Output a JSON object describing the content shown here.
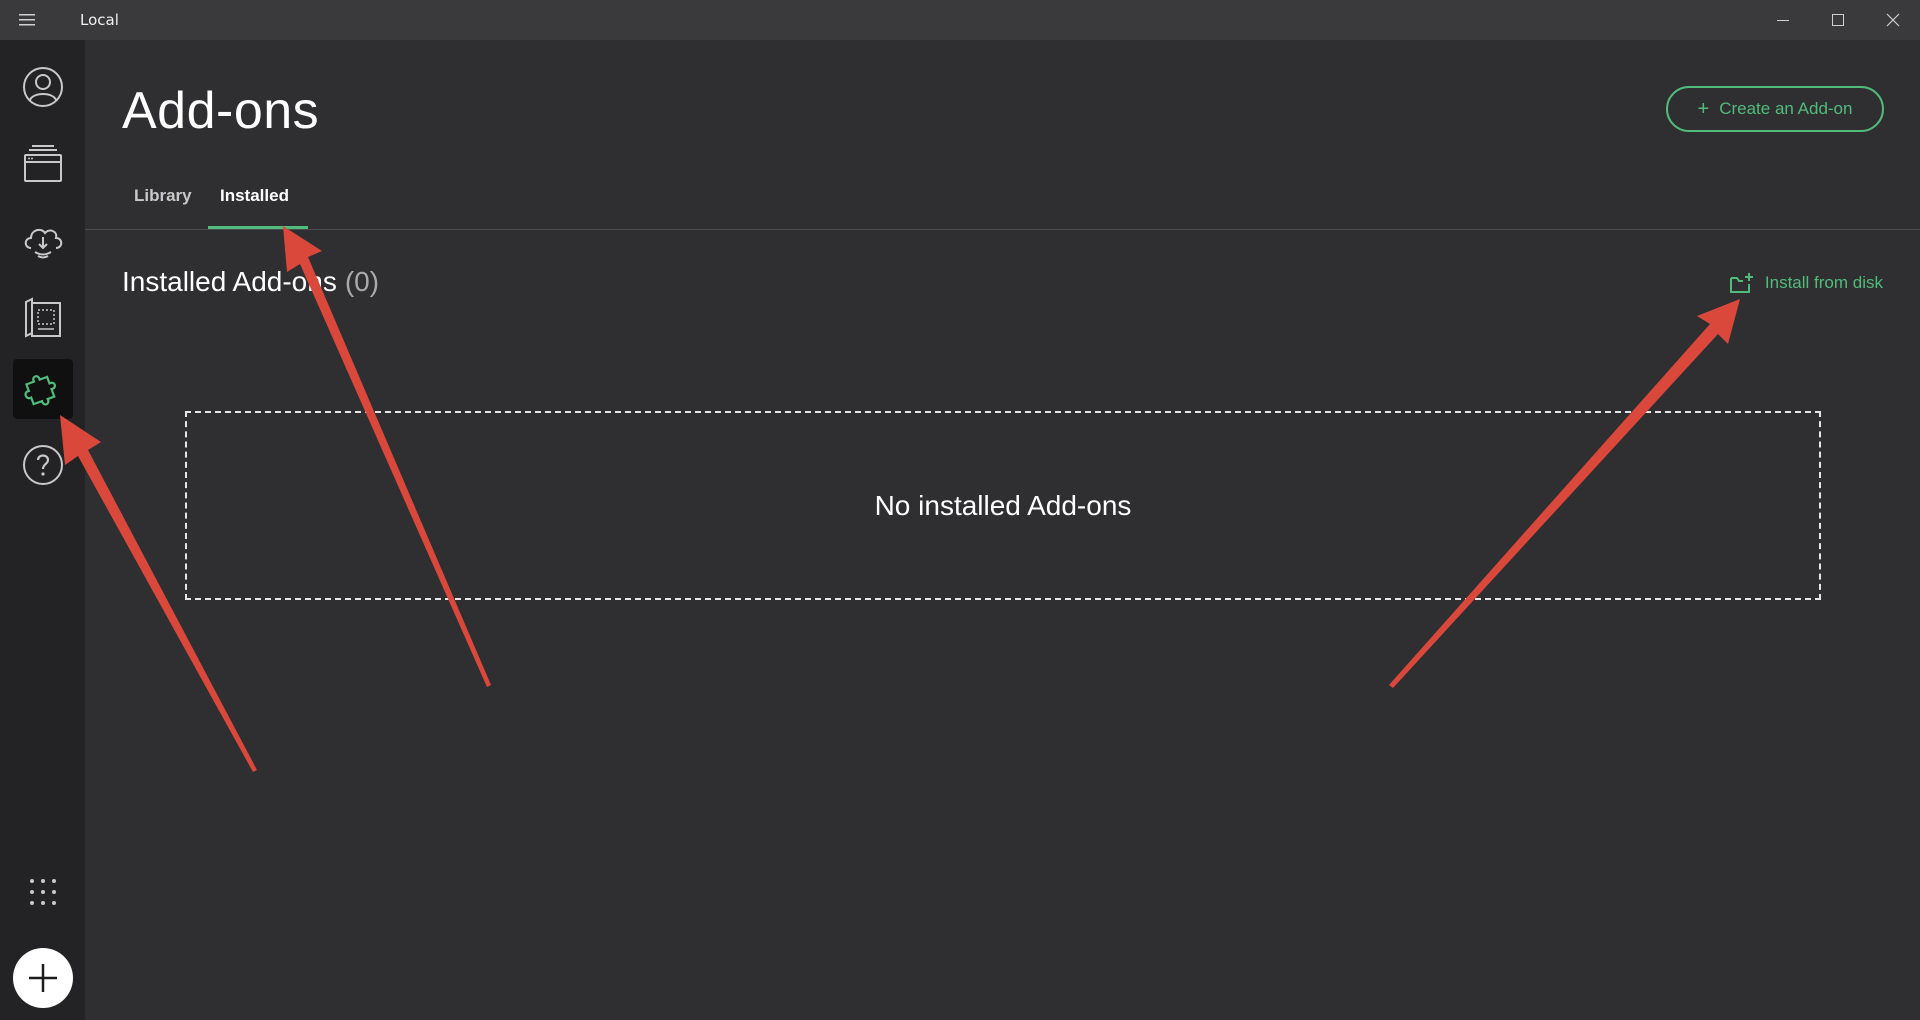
{
  "window": {
    "title": "Local",
    "menu_icon": "hamburger-icon",
    "controls": [
      "minimize-icon",
      "maximize-icon",
      "close-icon"
    ]
  },
  "sidebar": {
    "items": [
      {
        "name": "profile",
        "icon": "user-avatar-icon"
      },
      {
        "name": "sites",
        "icon": "stacked-windows-icon"
      },
      {
        "name": "connect",
        "icon": "cloud-icon"
      },
      {
        "name": "blueprints",
        "icon": "blueprint-icon"
      },
      {
        "name": "add-ons",
        "icon": "puzzle-icon",
        "active": true
      },
      {
        "name": "help",
        "icon": "question-icon"
      }
    ],
    "grid_icon": "app-grid-icon",
    "add_icon": "plus-icon"
  },
  "header": {
    "title": "Add-ons",
    "create_button": "Create an Add-on"
  },
  "tabs": [
    {
      "label": "Library",
      "active": false
    },
    {
      "label": "Installed",
      "active": true
    }
  ],
  "installed": {
    "title": "Installed Add-ons",
    "count": "(0)",
    "install_from_disk": "Install from disk",
    "empty_message": "No installed Add-ons"
  },
  "colors": {
    "accent": "#51bb7b",
    "annotation_arrow": "#d9483b",
    "background": "#2f2f31",
    "sidebar": "#232325"
  }
}
